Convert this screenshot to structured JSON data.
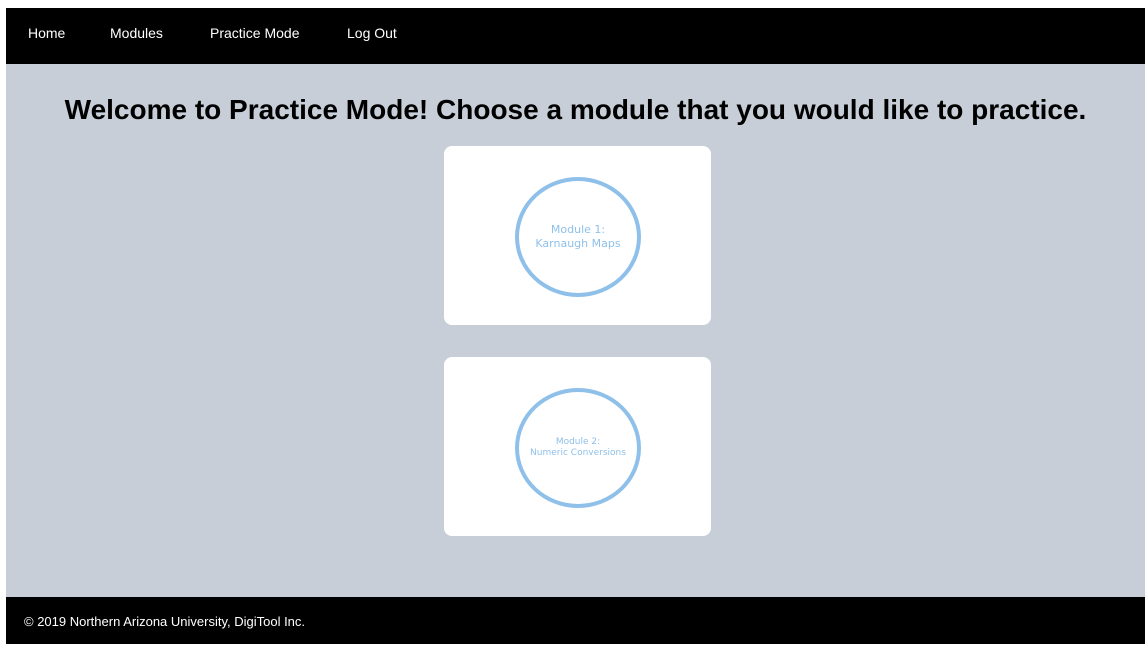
{
  "nav": {
    "items": [
      {
        "label": "Home"
      },
      {
        "label": "Modules"
      },
      {
        "label": "Practice Mode"
      },
      {
        "label": "Log Out"
      }
    ]
  },
  "main": {
    "title": "Welcome to Practice Mode! Choose a module that you would like to practice.",
    "modules": [
      {
        "line1": "Module 1:",
        "line2": "Karnaugh Maps"
      },
      {
        "line1": "Module 2:",
        "line2": "Numeric Conversions"
      }
    ]
  },
  "footer": {
    "text": "© 2019 Northern Arizona University, DigiTool Inc."
  },
  "colors": {
    "nav_background": "#000000",
    "page_background": "#c7ced8",
    "card_background": "#ffffff",
    "circle_accent": "#8fc0ea"
  }
}
